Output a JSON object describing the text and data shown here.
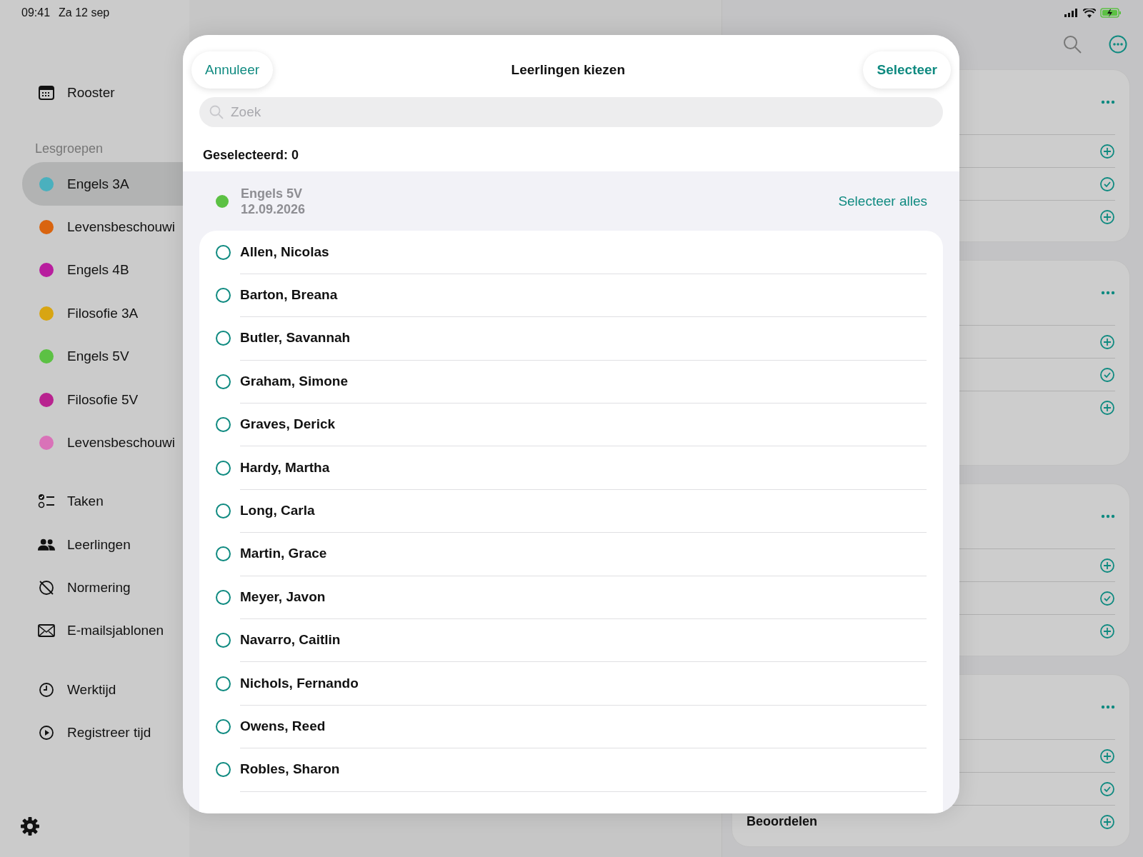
{
  "status_bar": {
    "time": "09:41",
    "date": "Za 12 sep"
  },
  "sidebar": {
    "top_items": [
      {
        "label": "Rooster",
        "kind": "calendar"
      }
    ],
    "section_title": "Lesgroepen",
    "groups": [
      {
        "label": "Engels 3A",
        "color": "#4ab0be",
        "selected": true
      },
      {
        "label": "Levensbeschouwi",
        "color": "#d9640f",
        "selected": false
      },
      {
        "label": "Engels 4B",
        "color": "#b81e9e",
        "selected": false
      },
      {
        "label": "Filosofie 3A",
        "color": "#d8a512",
        "selected": false
      },
      {
        "label": "Engels 5V",
        "color": "#5cc144",
        "selected": false
      },
      {
        "label": "Filosofie 5V",
        "color": "#b8238f",
        "selected": false
      },
      {
        "label": "Levensbeschouwi",
        "color": "#d972b8",
        "selected": false
      }
    ],
    "tools": [
      {
        "label": "Taken",
        "kind": "tasks"
      },
      {
        "label": "Leerlingen",
        "kind": "people"
      },
      {
        "label": "Normering",
        "kind": "nosign"
      },
      {
        "label": "E-mailsjablonen",
        "kind": "mail"
      }
    ],
    "time_items": [
      {
        "label": "Werktijd",
        "kind": "clock"
      },
      {
        "label": "Registreer tijd",
        "kind": "play"
      }
    ]
  },
  "right_panel": {
    "cards": [
      {
        "rows": [
          {
            "kind": "add"
          },
          {
            "kind": "done"
          },
          {
            "kind": "add"
          }
        ]
      },
      {
        "rows": [
          {
            "kind": "add"
          },
          {
            "kind": "done"
          },
          {
            "kind": "add"
          }
        ]
      },
      {
        "rows": [
          {
            "kind": "add"
          },
          {
            "kind": "done"
          },
          {
            "kind": "add"
          }
        ]
      },
      {
        "rows": [
          {
            "kind": "add"
          },
          {
            "kind": "done"
          },
          {
            "kind": "add",
            "label": "Beoordelen"
          }
        ]
      }
    ]
  },
  "sheet": {
    "cancel": "Annuleer",
    "title": "Leerlingen kiezen",
    "confirm": "Selecteer",
    "search": {
      "placeholder": "Zoek"
    },
    "selected_count": "Geselecteerd: 0",
    "group": {
      "name": "Engels 5V",
      "date": "12.09.2026",
      "color": "#5cc144",
      "select_all": "Selecteer alles"
    },
    "students": [
      {
        "name": "Allen, Nicolas",
        "selected": false
      },
      {
        "name": "Barton, Breana",
        "selected": false
      },
      {
        "name": "Butler, Savannah",
        "selected": false
      },
      {
        "name": "Graham, Simone",
        "selected": false
      },
      {
        "name": "Graves, Derick",
        "selected": false
      },
      {
        "name": "Hardy, Martha",
        "selected": false
      },
      {
        "name": "Long, Carla",
        "selected": false
      },
      {
        "name": "Martin, Grace",
        "selected": false
      },
      {
        "name": "Meyer, Javon",
        "selected": false
      },
      {
        "name": "Navarro, Caitlin",
        "selected": false
      },
      {
        "name": "Nichols, Fernando",
        "selected": false
      },
      {
        "name": "Owens, Reed",
        "selected": false
      },
      {
        "name": "Robles, Sharon",
        "selected": false
      }
    ]
  }
}
